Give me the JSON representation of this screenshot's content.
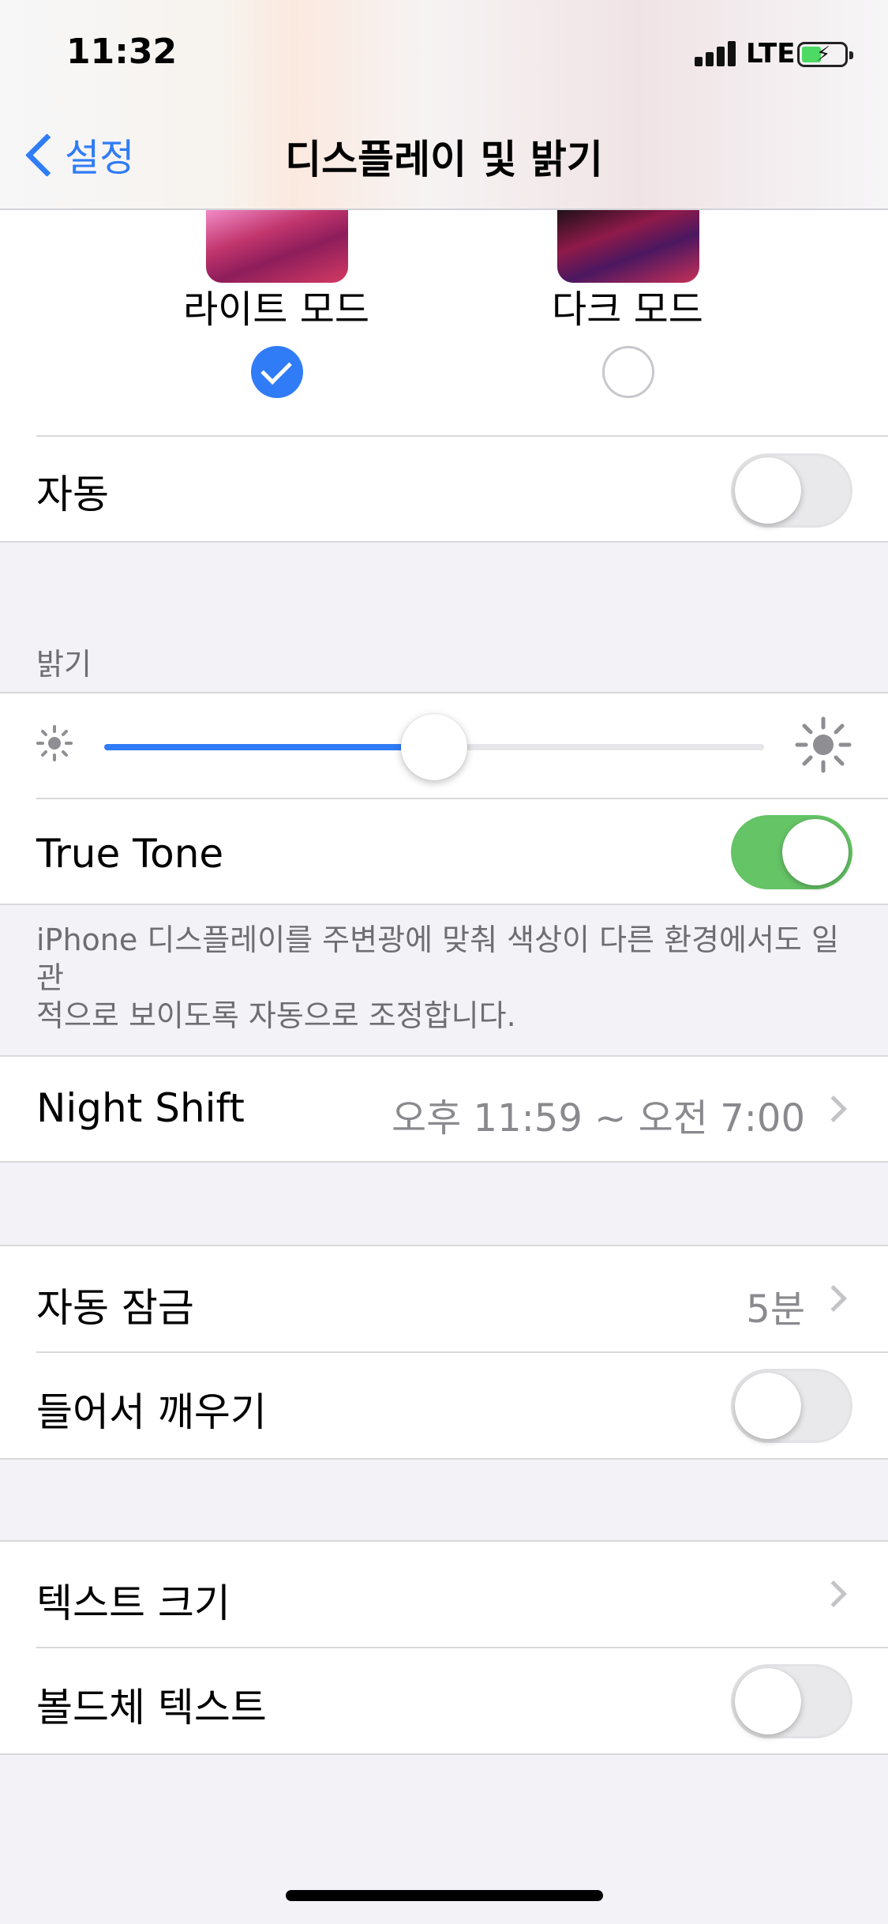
{
  "status_bar": {
    "time": "11:32",
    "network": "LTE"
  },
  "nav": {
    "back_label": "설정",
    "title": "디스플레이 및 밝기"
  },
  "appearance": {
    "light_label": "라이트 모드",
    "dark_label": "다크 모드",
    "selected": "light",
    "auto_label": "자동",
    "auto_on": false
  },
  "brightness": {
    "header": "밝기",
    "level": 0.5,
    "true_tone_label": "True Tone",
    "true_tone_on": true,
    "footer": [
      "iPhone 디스플레이를 주변광에 맞춰 색상이 다른 환경에서도 일관",
      "적으로 보이도록 자동으로 조정합니다."
    ]
  },
  "night_shift": {
    "label": "Night Shift",
    "value": "오후 11:59 ~ 오전 7:00"
  },
  "lock": {
    "auto_lock_label": "자동 잠금",
    "auto_lock_value": "5분",
    "raise_to_wake_label": "들어서 깨우기",
    "raise_to_wake_on": false
  },
  "text": {
    "text_size_label": "텍스트 크기",
    "bold_text_label": "볼드체 텍스트",
    "bold_text_on": false
  },
  "colors": {
    "accent": "#2f7cf6",
    "toggle_on": "#65c466",
    "background": "#f2f2f7"
  }
}
